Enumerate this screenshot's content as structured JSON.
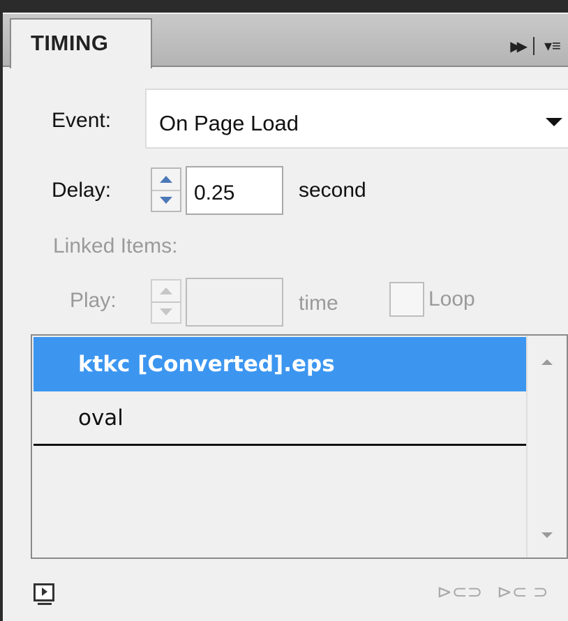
{
  "panel": {
    "tab_title": "TIMING"
  },
  "event": {
    "label": "Event:",
    "selected": "On Page Load"
  },
  "delay": {
    "label": "Delay:",
    "value": "0.25",
    "unit": "second"
  },
  "linked_items": {
    "label": "Linked Items:"
  },
  "play": {
    "label": "Play:",
    "value": "",
    "unit": "time",
    "loop_label": "Loop"
  },
  "list": {
    "items": [
      {
        "label": "ktkc [Converted].eps",
        "selected": true
      },
      {
        "label": "oval",
        "selected": false
      }
    ]
  },
  "colors": {
    "selection": "#3c96f0",
    "stepper_arrow": "#4c78b8"
  }
}
